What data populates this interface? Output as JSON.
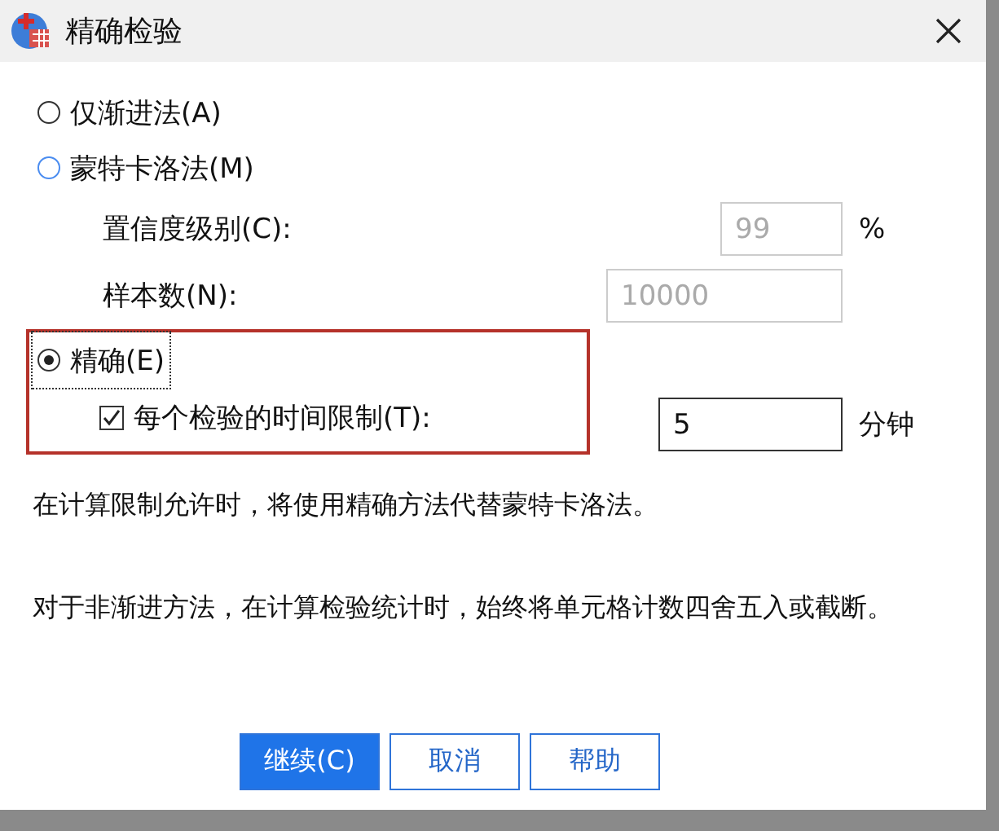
{
  "window": {
    "title": "精确检验"
  },
  "methods": [
    {
      "label": "仅渐进法(A)",
      "selected": false,
      "hovered": false
    },
    {
      "label": "蒙特卡洛法(M)",
      "selected": false,
      "hovered": true
    },
    {
      "label": "精确(E)",
      "selected": true,
      "hovered": false
    }
  ],
  "monte_carlo": {
    "confidence": {
      "label": "置信度级别(C):",
      "value": "99",
      "unit": "%",
      "disabled": true
    },
    "samples": {
      "label": "样本数(N):",
      "value": "10000",
      "disabled": true
    }
  },
  "time_limit": {
    "label": "每个检验的时间限制(T):",
    "checked": true,
    "value": "5",
    "unit": "分钟"
  },
  "notes": [
    {
      "text": "在计算限制允许时，将使用精确方法代替蒙特卡洛法。"
    },
    {
      "text": "对于非渐进方法，在计算检验统计时，始终将单元格计数四舍五入或截断。"
    }
  ],
  "buttons": [
    {
      "label": "继续(C)",
      "kind": "primary"
    },
    {
      "label": "取消",
      "kind": "normal"
    },
    {
      "label": "帮助",
      "kind": "normal"
    }
  ]
}
